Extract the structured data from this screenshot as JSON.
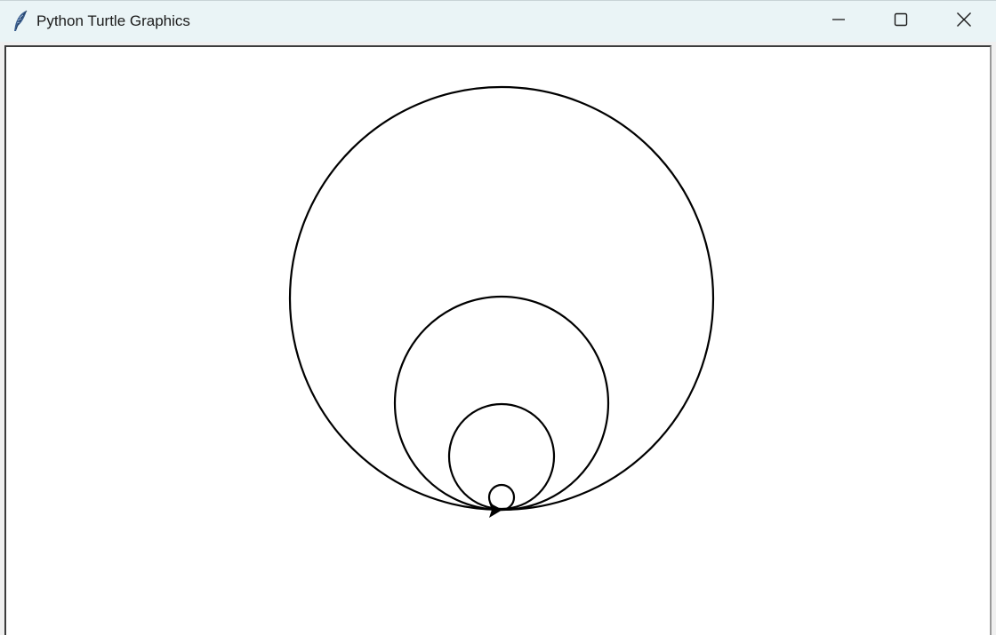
{
  "window": {
    "title": "Python Turtle Graphics",
    "icon": "feather-icon",
    "controls": {
      "minimize_icon": "minimize-icon",
      "maximize_icon": "maximize-icon",
      "close_icon": "close-icon"
    }
  },
  "canvas": {
    "background": "#ffffff",
    "pen_color": "#000000",
    "drawing": "four circles tangent at a common bottom point, turtle arrow cursor at the tangent point",
    "circle_count": 4
  }
}
